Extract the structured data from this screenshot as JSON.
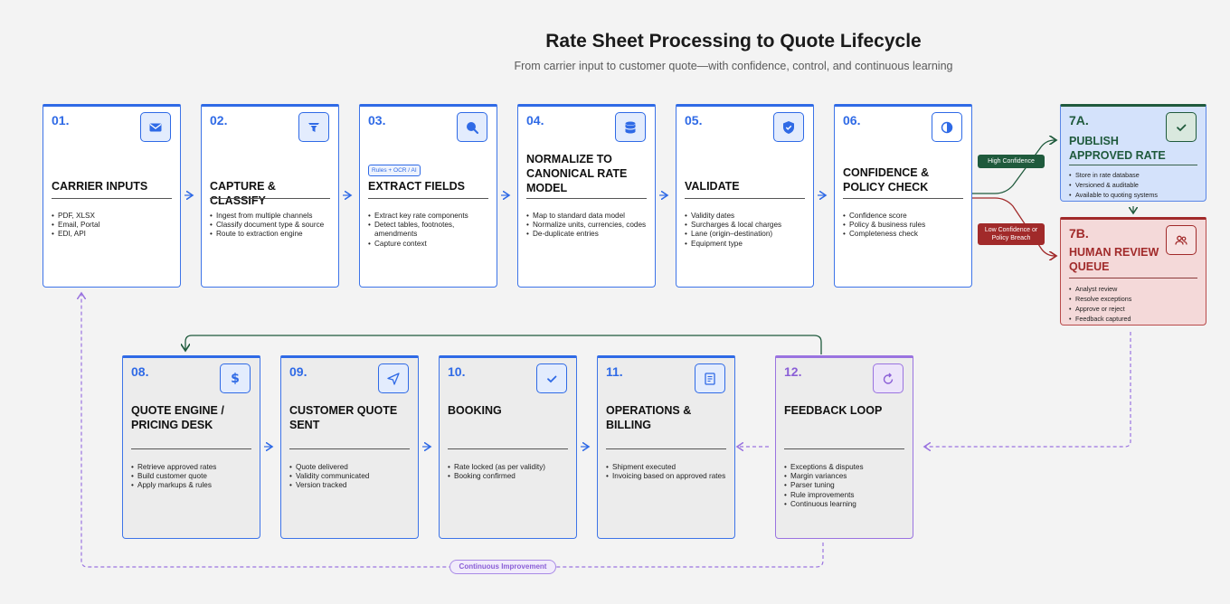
{
  "header": {
    "title": "Rate Sheet Processing to Quote Lifecycle",
    "subtitle": "From carrier input to customer quote—with confidence, control, and continuous learning"
  },
  "steps": [
    {
      "num": "01.",
      "title": "CARRIER INPUTS",
      "icon": "envelope-icon",
      "bullets": [
        "PDF, XLSX",
        "Email, Portal",
        "EDI, API"
      ]
    },
    {
      "num": "02.",
      "title": "CAPTURE & CLASSIFY",
      "icon": "filter-icon",
      "bullets": [
        "Ingest from multiple channels",
        "Classify document type & source",
        "Route to extraction engine"
      ]
    },
    {
      "num": "03.",
      "title": "EXTRACT FIELDS",
      "tag": "Rules + OCR / AI",
      "icon": "search-icon",
      "bullets": [
        "Extract key rate components",
        "Detect tables, footnotes, amendments",
        "Capture context"
      ]
    },
    {
      "num": "04.",
      "title": "NORMALIZE TO CANONICAL RATE MODEL",
      "icon": "database-icon",
      "bullets": [
        "Map to standard data model",
        "Normalize units, currencies, codes",
        "De-duplicate entries"
      ]
    },
    {
      "num": "05.",
      "title": "VALIDATE",
      "icon": "shield-check-icon",
      "bullets": [
        "Validity dates",
        "Surcharges & local charges",
        "Lane (origin–destination)",
        "Equipment type"
      ]
    },
    {
      "num": "06.",
      "title": "CONFIDENCE & POLICY CHECK",
      "icon": "half-circle-icon",
      "bullets": [
        "Confidence score",
        "Policy & business rules",
        "Completeness check"
      ]
    },
    {
      "num": "7A.",
      "title": "PUBLISH APPROVED RATE",
      "icon": "check-icon",
      "bullets": [
        "Store in rate database",
        "Versioned & auditable",
        "Available to quoting systems"
      ]
    },
    {
      "num": "7B.",
      "title": "HUMAN REVIEW QUEUE",
      "icon": "users-icon",
      "bullets": [
        "Analyst review",
        "Resolve exceptions",
        "Approve or reject",
        "Feedback captured"
      ]
    },
    {
      "num": "08.",
      "title": "QUOTE ENGINE / PRICING DESK",
      "icon": "dollar-icon",
      "bullets": [
        "Retrieve approved rates",
        "Build customer quote",
        "Apply markups & rules"
      ]
    },
    {
      "num": "09.",
      "title": "CUSTOMER QUOTE SENT",
      "icon": "send-icon",
      "bullets": [
        "Quote delivered",
        "Validity communicated",
        "Version tracked"
      ]
    },
    {
      "num": "10.",
      "title": "BOOKING",
      "icon": "check-icon",
      "bullets": [
        "Rate locked (as per validity)",
        "Booking confirmed"
      ]
    },
    {
      "num": "11.",
      "title": "OPERATIONS & BILLING",
      "icon": "invoice-icon",
      "bullets": [
        "Shipment executed",
        "Invoicing based on approved rates"
      ]
    },
    {
      "num": "12.",
      "title": "FEEDBACK LOOP",
      "icon": "refresh-icon",
      "bullets": [
        "Exceptions & disputes",
        "Margin variances",
        "Parser tuning",
        "Rule improvements",
        "Continuous learning"
      ]
    }
  ],
  "branches": {
    "high": "High Confidence",
    "low": "Low Confidence or Policy Breach"
  },
  "loop_label": "Continuous Improvement",
  "colors": {
    "accent": "#2f6ae6",
    "publish": "#1f5a3c",
    "review": "#a12a2a",
    "feedback": "#9a73e0"
  }
}
